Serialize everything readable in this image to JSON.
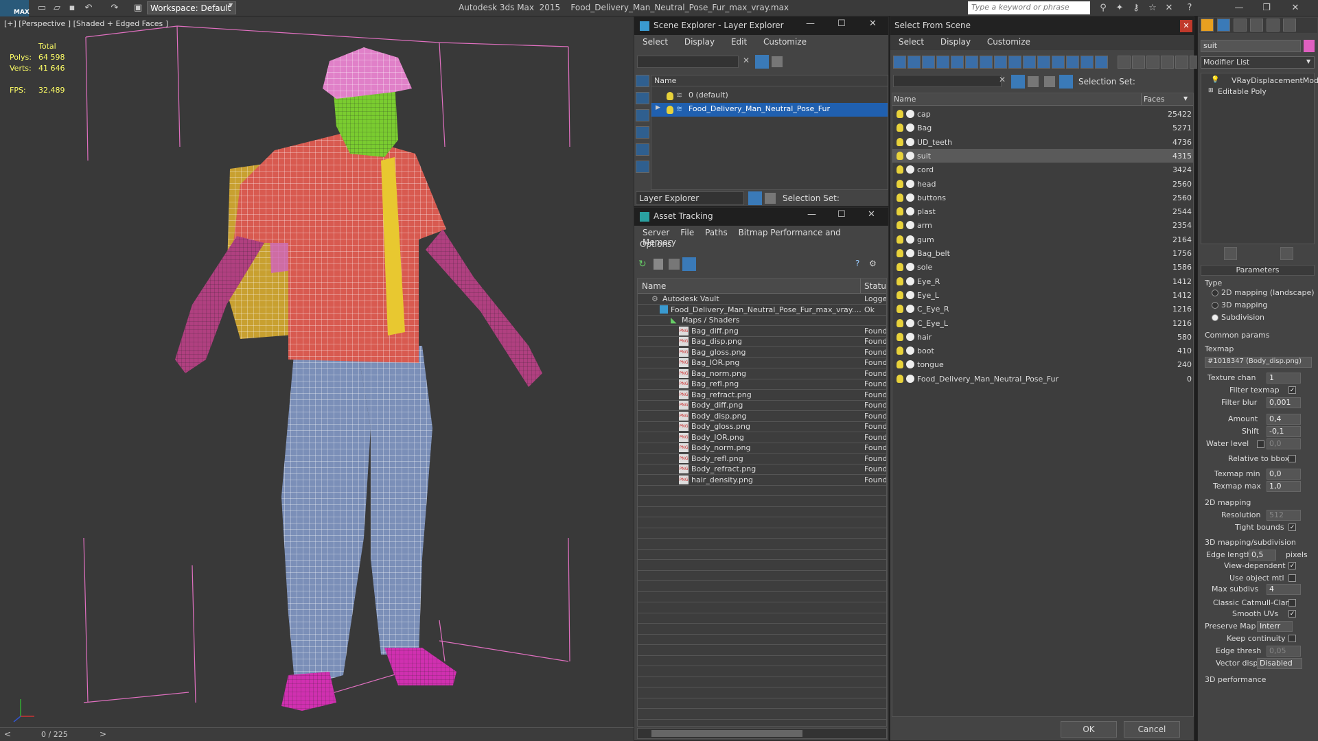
{
  "app": {
    "title": "Autodesk 3ds Max  2015    Food_Delivery_Man_Neutral_Pose_Fur_max_vray.max",
    "workspace": "Workspace: Default",
    "search_placeholder": "Type a keyword or phrase",
    "logo": "MAX"
  },
  "viewport": {
    "label": "[+] [Perspective ] [Shaded + Edged Faces ]",
    "stats": {
      "total_label": "Total",
      "polys_label": "Polys:",
      "polys": "64 598",
      "verts_label": "Verts:",
      "verts": "41 646",
      "fps_label": "FPS:",
      "fps": "32,489"
    },
    "timeline": "0 / 225"
  },
  "scene_explorer": {
    "title": "Scene Explorer - Layer Explorer",
    "menu": [
      "Select",
      "Display",
      "Edit",
      "Customize"
    ],
    "col_name": "Name",
    "layers": [
      {
        "name": "0 (default)"
      },
      {
        "name": "Food_Delivery_Man_Neutral_Pose_Fur"
      }
    ],
    "footer_label": "Layer Explorer",
    "selection_set": "Selection Set:"
  },
  "asset_tracking": {
    "title": "Asset Tracking",
    "menu": [
      "Server",
      "File",
      "Paths",
      "Bitmap Performance and Memory"
    ],
    "menu2": "Options",
    "col_name": "Name",
    "col_status": "Status",
    "rows": [
      {
        "name": "Autodesk Vault",
        "status": "Logged"
      },
      {
        "name": "Food_Delivery_Man_Neutral_Pose_Fur_max_vray....",
        "status": "Ok"
      },
      {
        "name": "Maps / Shaders",
        "status": ""
      },
      {
        "name": "Bag_diff.png",
        "status": "Found"
      },
      {
        "name": "Bag_disp.png",
        "status": "Found"
      },
      {
        "name": "Bag_gloss.png",
        "status": "Found"
      },
      {
        "name": "Bag_IOR.png",
        "status": "Found"
      },
      {
        "name": "Bag_norm.png",
        "status": "Found"
      },
      {
        "name": "Bag_refl.png",
        "status": "Found"
      },
      {
        "name": "Bag_refract.png",
        "status": "Found"
      },
      {
        "name": "Body_diff.png",
        "status": "Found"
      },
      {
        "name": "Body_disp.png",
        "status": "Found"
      },
      {
        "name": "Body_gloss.png",
        "status": "Found"
      },
      {
        "name": "Body_IOR.png",
        "status": "Found"
      },
      {
        "name": "Body_norm.png",
        "status": "Found"
      },
      {
        "name": "Body_refl.png",
        "status": "Found"
      },
      {
        "name": "Body_refract.png",
        "status": "Found"
      },
      {
        "name": "hair_density.png",
        "status": "Found"
      }
    ]
  },
  "select_from_scene": {
    "title": "Select From Scene",
    "menu": [
      "Select",
      "Display",
      "Customize"
    ],
    "selection_set": "Selection Set:",
    "col_name": "Name",
    "col_faces": "Faces",
    "ok": "OK",
    "cancel": "Cancel",
    "objects": [
      {
        "name": "cap",
        "faces": "25422"
      },
      {
        "name": "Bag",
        "faces": "5271"
      },
      {
        "name": "UD_teeth",
        "faces": "4736"
      },
      {
        "name": "suit",
        "faces": "4315"
      },
      {
        "name": "cord",
        "faces": "3424"
      },
      {
        "name": "head",
        "faces": "2560"
      },
      {
        "name": "buttons",
        "faces": "2560"
      },
      {
        "name": "plast",
        "faces": "2544"
      },
      {
        "name": "arm",
        "faces": "2354"
      },
      {
        "name": "gum",
        "faces": "2164"
      },
      {
        "name": "Bag_belt",
        "faces": "1756"
      },
      {
        "name": "sole",
        "faces": "1586"
      },
      {
        "name": "Eye_R",
        "faces": "1412"
      },
      {
        "name": "Eye_L",
        "faces": "1412"
      },
      {
        "name": "C_Eye_R",
        "faces": "1216"
      },
      {
        "name": "C_Eye_L",
        "faces": "1216"
      },
      {
        "name": "hair",
        "faces": "580"
      },
      {
        "name": "boot",
        "faces": "410"
      },
      {
        "name": "tongue",
        "faces": "240"
      },
      {
        "name": "Food_Delivery_Man_Neutral_Pose_Fur",
        "faces": "0"
      }
    ]
  },
  "command_panel": {
    "object_name": "suit",
    "modifier_list": "Modifier List",
    "stack": [
      "VRayDisplacementMod",
      "Editable Poly"
    ],
    "rollout": "Parameters",
    "type_label": "Type",
    "types": [
      "2D mapping (landscape)",
      "3D mapping",
      "Subdivision"
    ],
    "common_params": "Common params",
    "texmap_label": "Texmap",
    "texmap": "#1018347 (Body_disp.png)",
    "texture_chan_label": "Texture chan",
    "texture_chan": "1",
    "filter_texmap": "Filter texmap",
    "filter_blur_label": "Filter blur",
    "filter_blur": "0,001",
    "amount_label": "Amount",
    "amount": "0,4",
    "shift_label": "Shift",
    "shift": "-0,1",
    "water_level": "Water level",
    "water_value": "0,0",
    "relative_bbox": "Relative to bbox",
    "texmap_min_label": "Texmap min",
    "texmap_min": "0,0",
    "texmap_max_label": "Texmap max",
    "texmap_max": "1,0",
    "mapping2d": "2D mapping",
    "resolution_label": "Resolution",
    "resolution": "512",
    "tight_bounds": "Tight bounds",
    "mapping3d": "3D mapping/subdivision",
    "edge_length_label": "Edge length",
    "edge_length": "0,5",
    "pixels": "pixels",
    "view_dependent": "View-dependent",
    "use_object_mtl": "Use object mtl",
    "max_subdivs_label": "Max subdivs",
    "max_subdivs": "4",
    "classic_cc": "Classic Catmull-Clark",
    "smooth_uvs": "Smooth UVs",
    "preserve_map_label": "Preserve Map Bnd",
    "preserve_map": "Interr",
    "keep_continuity": "Keep continuity",
    "edge_thresh_label": "Edge thresh",
    "edge_thresh": "0,05",
    "vector_displ_label": "Vector displ",
    "vector_displ": "Disabled",
    "perf": "3D performance"
  }
}
